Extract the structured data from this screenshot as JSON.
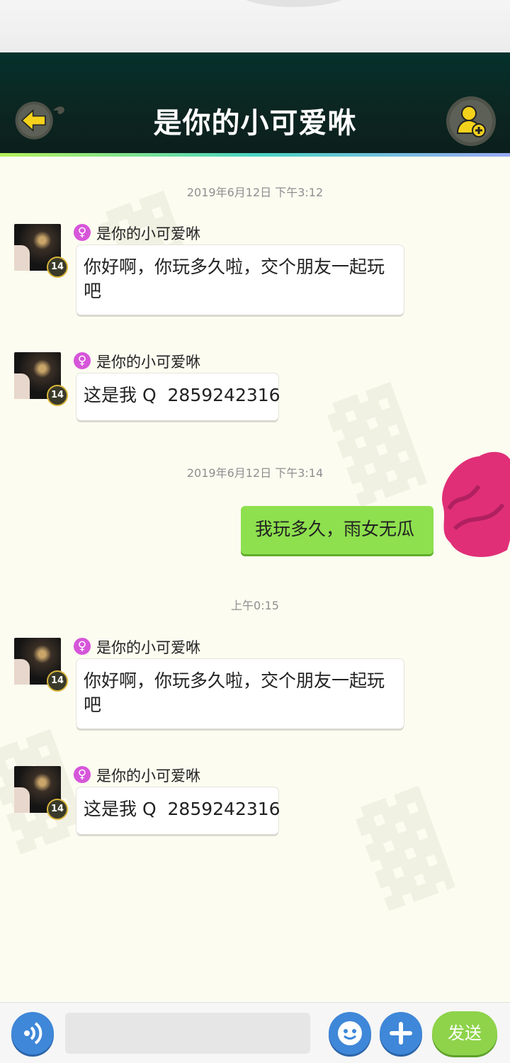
{
  "header": {
    "title": "是你的小可爱咻"
  },
  "messages": [
    {
      "type": "timestamp",
      "text": "2019年6月12日 下午3:12"
    },
    {
      "type": "incoming",
      "sender": "是你的小可爱咻",
      "level": "14",
      "text": "你好啊，你玩多久啦，交个朋友一起玩吧"
    },
    {
      "type": "incoming",
      "sender": "是你的小可爱咻",
      "level": "14",
      "text": "这是我 Q  2859242316"
    },
    {
      "type": "timestamp",
      "text": "2019年6月12日 下午3:14"
    },
    {
      "type": "outgoing",
      "text": "我玩多久，雨女无瓜"
    },
    {
      "type": "timestamp",
      "text": "上午0:15"
    },
    {
      "type": "incoming",
      "sender": "是你的小可爱咻",
      "level": "14",
      "text": "你好啊，你玩多久啦，交个朋友一起玩吧"
    },
    {
      "type": "incoming",
      "sender": "是你的小可爱咻",
      "level": "14",
      "text": "这是我 Q  2859242316"
    }
  ],
  "composer": {
    "placeholder": "",
    "send_label": "发送"
  },
  "colors": {
    "header_bg": "#0c2621",
    "accent_yellow": "#f4d21c",
    "self_bubble": "#8ee04e",
    "button_blue": "#3f87d8",
    "send_green": "#8ed34a",
    "scribble": "#e02f77"
  },
  "icons": {
    "back": "arrow-left-icon",
    "add_friend": "add-user-icon",
    "voice": "voice-icon",
    "emoji": "emoji-icon",
    "more": "plus-icon",
    "gender": "female-icon"
  }
}
